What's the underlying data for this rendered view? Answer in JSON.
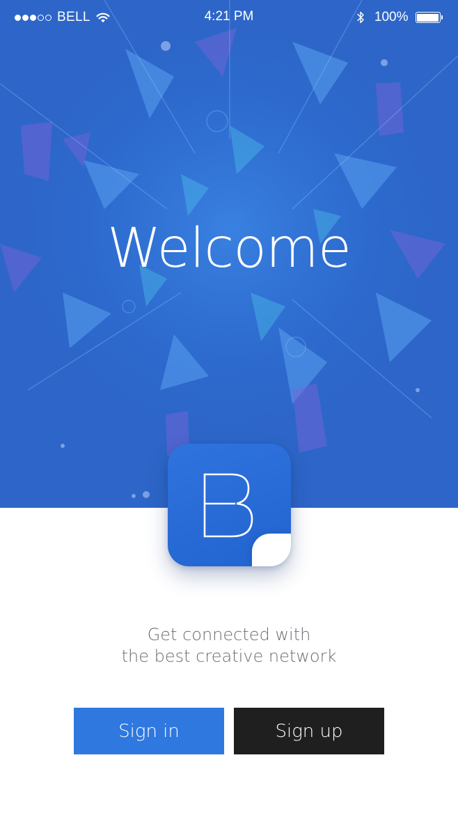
{
  "status_bar": {
    "signal": {
      "filled": 3,
      "total": 5
    },
    "carrier": "BELL",
    "time": "4:21 PM",
    "battery": "100%",
    "battery_level": 1.0,
    "icons": [
      "wifi-icon",
      "bluetooth-icon",
      "battery-icon"
    ]
  },
  "hero": {
    "title": "Welcome",
    "background_color": "#2d66c8"
  },
  "logo": {
    "letter": "B",
    "color": "#2a6bd8"
  },
  "tagline": {
    "line1": "Get connected with",
    "line2": "the best creative network"
  },
  "actions": {
    "signin_label": "Sign in",
    "signup_label": "Sign up",
    "signin_color": "#2f78e0",
    "signup_color": "#1f1f20"
  }
}
